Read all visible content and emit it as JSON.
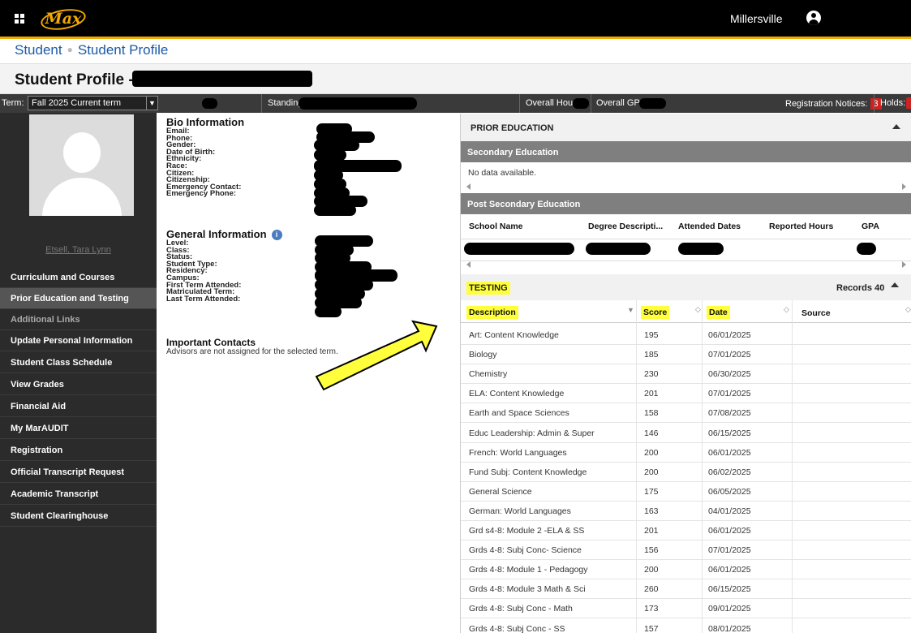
{
  "topbar": {
    "logo": "Max",
    "institution": "Millersville"
  },
  "breadcrumb": {
    "root": "Student",
    "current": "Student Profile"
  },
  "page": {
    "title": "Student Profile -"
  },
  "termbar": {
    "term_label": "Term:",
    "term_value": "Fall 2025 Current term",
    "standing_label": "Standing",
    "overall_hours_label": "Overall Hours",
    "overall_gpa_label": "Overall GPA:",
    "registration_notices_label": "Registration Notices:",
    "registration_notices_count": "3",
    "holds_label": "Holds:"
  },
  "sidebar": {
    "student_name": "Etsell, Tara Lynn",
    "items": [
      {
        "label": "Curriculum and Courses"
      },
      {
        "label": "Prior Education and Testing"
      },
      {
        "label": "Additional Links"
      },
      {
        "label": "Update Personal Information"
      },
      {
        "label": "Student Class Schedule"
      },
      {
        "label": "View Grades"
      },
      {
        "label": "Financial Aid"
      },
      {
        "label": "My MarAUDIT"
      },
      {
        "label": "Registration"
      },
      {
        "label": "Official Transcript Request"
      },
      {
        "label": "Academic Transcript"
      },
      {
        "label": "Student Clearinghouse"
      }
    ]
  },
  "bio": {
    "heading": "Bio Information",
    "fields": [
      "Email:",
      "Phone:",
      "Gender:",
      "Date of Birth:",
      "Ethnicity:",
      "Race:",
      "Citizen:",
      "Citizenship:",
      "Emergency Contact:",
      "Emergency Phone:"
    ]
  },
  "general": {
    "heading": "General Information",
    "fields": [
      "Level:",
      "Class:",
      "Status:",
      "Student Type:",
      "Residency:",
      "Campus:",
      "First Term Attended:",
      "Matriculated Term:",
      "Last Term Attended:"
    ]
  },
  "contacts": {
    "heading": "Important Contacts",
    "message": "Advisors are not assigned for the selected term."
  },
  "prior_education": {
    "heading": "PRIOR EDUCATION",
    "secondary_heading": "Secondary Education",
    "secondary_empty": "No data available.",
    "post_secondary_heading": "Post Secondary Education",
    "columns": [
      "School Name",
      "Degree Descripti...",
      "Attended Dates",
      "Reported Hours",
      "GPA"
    ]
  },
  "testing": {
    "heading": "TESTING",
    "records_label": "Records 40",
    "columns": [
      "Description",
      "Score",
      "Date",
      "Source"
    ],
    "rows": [
      {
        "description": "Art: Content Knowledge",
        "score": "195",
        "date": "06/01/2025"
      },
      {
        "description": "Biology",
        "score": "185",
        "date": "07/01/2025"
      },
      {
        "description": "Chemistry",
        "score": "230",
        "date": "06/30/2025"
      },
      {
        "description": "ELA: Content Knowledge",
        "score": "201",
        "date": "07/01/2025"
      },
      {
        "description": "Earth and Space Sciences",
        "score": "158",
        "date": "07/08/2025"
      },
      {
        "description": "Educ Leadership: Admin & Super",
        "score": "146",
        "date": "06/15/2025"
      },
      {
        "description": "French: World Languages",
        "score": "200",
        "date": "06/01/2025"
      },
      {
        "description": "Fund Subj: Content Knowledge",
        "score": "200",
        "date": "06/02/2025"
      },
      {
        "description": "General Science",
        "score": "175",
        "date": "06/05/2025"
      },
      {
        "description": "German: World Languages",
        "score": "163",
        "date": "04/01/2025"
      },
      {
        "description": "Grd s4-8: Module 2 -ELA & SS",
        "score": "201",
        "date": "06/01/2025"
      },
      {
        "description": "Grds 4-8: Subj Conc- Science",
        "score": "156",
        "date": "07/01/2025"
      },
      {
        "description": "Grds 4-8: Module 1 - Pedagogy",
        "score": "200",
        "date": "06/01/2025"
      },
      {
        "description": "Grds 4-8: Module 3 Math & Sci",
        "score": "260",
        "date": "06/15/2025"
      },
      {
        "description": "Grds 4-8: Subj Conc - Math",
        "score": "173",
        "date": "09/01/2025"
      },
      {
        "description": "Grds 4-8: Subj Conc - SS",
        "score": "157",
        "date": "08/01/2025"
      }
    ]
  },
  "colors": {
    "brand_gold": "#f2a900",
    "highlight": "#ffff3c",
    "link_blue": "#1b5aa8",
    "sidebar_bg": "#2b2b2b"
  }
}
